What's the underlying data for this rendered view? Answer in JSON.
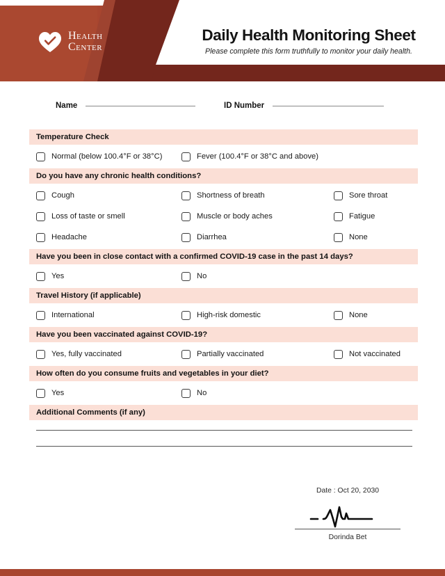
{
  "header": {
    "logo_line1": "Health",
    "logo_line2": "Center",
    "logo_icon": "heart-check-icon",
    "title": "Daily Health Monitoring Sheet",
    "subtitle": "Please complete this form truthfully to monitor your daily health.",
    "brand_color": "#a8452f",
    "accent_dark": "#73261c",
    "section_bar_color": "#fbdfd6"
  },
  "identity": {
    "name_label": "Name",
    "name_value": "",
    "id_label": "ID Number",
    "id_value": ""
  },
  "sections": [
    {
      "title": "Temperature Check",
      "options": [
        "Normal (below 100.4°F or 38°C)",
        "Fever (100.4°F or 38°C and above)"
      ],
      "columns": 2
    },
    {
      "title": "Do you have any chronic health conditions?",
      "options": [
        "Cough",
        "Shortness of breath",
        "Sore throat",
        "Loss of taste or smell",
        "Muscle or body aches",
        "Fatigue",
        "Headache",
        "Diarrhea",
        "None"
      ],
      "columns": 3
    },
    {
      "title": "Have you been in close contact with a confirmed COVID-19 case in the past 14 days?",
      "options": [
        "Yes",
        "No"
      ],
      "columns": 2
    },
    {
      "title": "Travel History (if applicable)",
      "options": [
        "International",
        "High-risk domestic",
        "None"
      ],
      "columns": 3
    },
    {
      "title": "Have you been vaccinated against COVID-19?",
      "options": [
        "Yes, fully vaccinated",
        "Partially vaccinated",
        "Not vaccinated"
      ],
      "columns": 3
    },
    {
      "title": "How often do you consume fruits and vegetables in your diet?",
      "options": [
        "Yes",
        "No"
      ],
      "columns": 2
    },
    {
      "title": "Additional Comments (if any)",
      "options": [],
      "columns": 0,
      "comment_lines": 2
    }
  ],
  "signature": {
    "date_text": "Date : Oct 20, 2030",
    "signer_name": "Dorinda Bet",
    "signature_icon": "ecg-signature-scribble"
  }
}
